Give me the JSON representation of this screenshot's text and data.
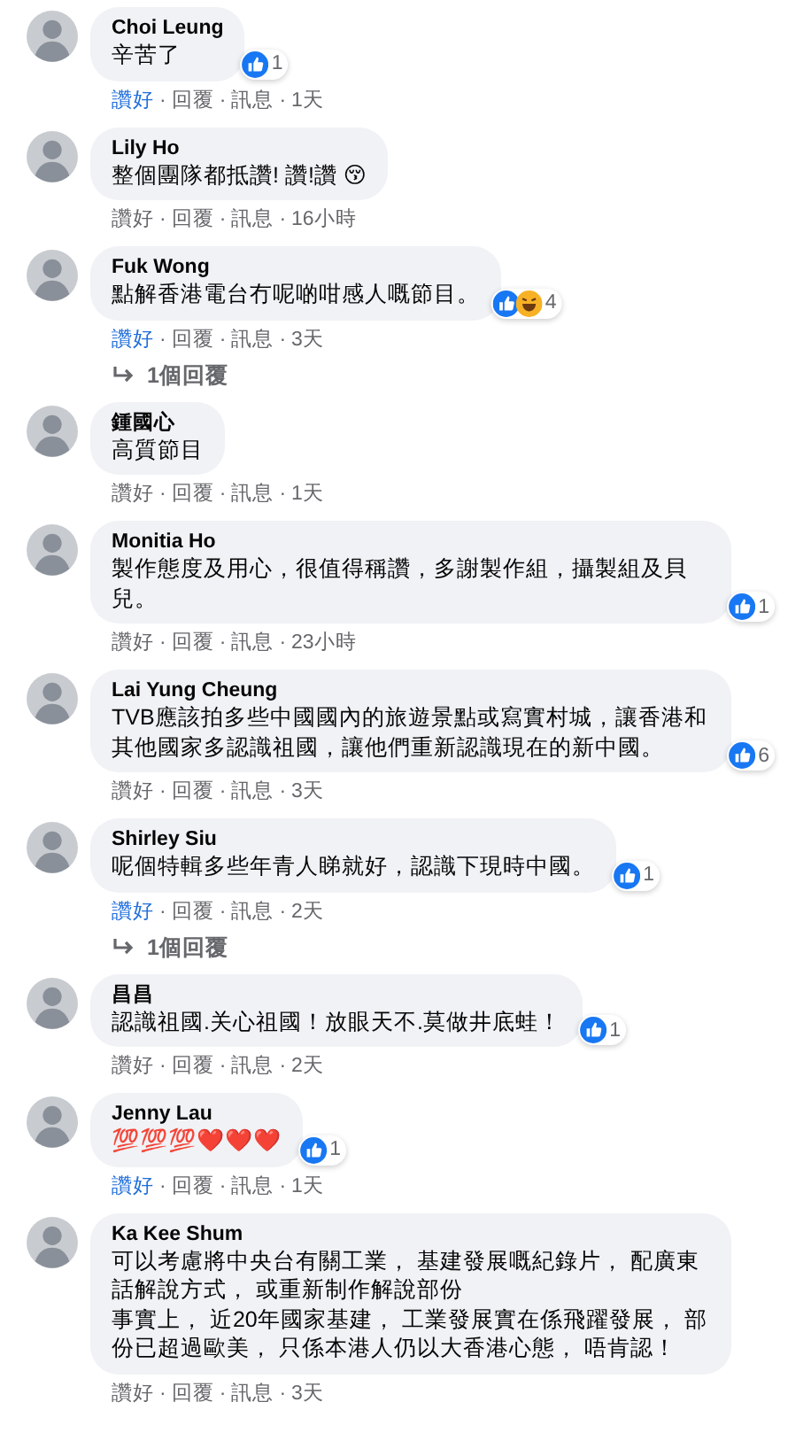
{
  "separator": "·",
  "comments": [
    {
      "name": "Choi Leung",
      "paragraphs": [
        "辛苦了"
      ],
      "liked": true,
      "like": "讚好",
      "reply": "回覆",
      "message": "訊息",
      "time": "1天",
      "reaction": {
        "like": true,
        "count": "1"
      }
    },
    {
      "name": "Lily Ho",
      "paragraphs": [
        "整個團隊都抵讚! 讚!讚 😚"
      ],
      "liked": false,
      "like": "讚好",
      "reply": "回覆",
      "message": "訊息",
      "time": "16小時"
    },
    {
      "name": "Fuk Wong",
      "paragraphs": [
        "點解香港電台冇呢啲咁感人嘅節目。"
      ],
      "liked": true,
      "like": "讚好",
      "reply": "回覆",
      "message": "訊息",
      "time": "3天",
      "reaction": {
        "like": true,
        "haha": true,
        "count": "4"
      },
      "replies": "1個回覆"
    },
    {
      "name": "鍾國心",
      "paragraphs": [
        "高質節目"
      ],
      "liked": false,
      "like": "讚好",
      "reply": "回覆",
      "message": "訊息",
      "time": "1天"
    },
    {
      "name": "Monitia Ho",
      "paragraphs": [
        "製作態度及用心，很值得稱讚，多謝製作組，攝製組及貝兒。"
      ],
      "liked": false,
      "like": "讚好",
      "reply": "回覆",
      "message": "訊息",
      "time": "23小時",
      "reaction": {
        "like": true,
        "count": "1"
      }
    },
    {
      "name": "Lai Yung Cheung",
      "paragraphs": [
        "TVB應該拍多些中國國內的旅遊景點或寫實村城，讓香港和其他國家多認識祖國，讓他們重新認識現在的新中國。"
      ],
      "liked": false,
      "like": "讚好",
      "reply": "回覆",
      "message": "訊息",
      "time": "3天",
      "reaction": {
        "like": true,
        "count": "6"
      }
    },
    {
      "name": "Shirley Siu",
      "paragraphs": [
        "呢個特輯多些年青人睇就好，認識下現時中國。"
      ],
      "liked": true,
      "like": "讚好",
      "reply": "回覆",
      "message": "訊息",
      "time": "2天",
      "reaction": {
        "like": true,
        "count": "1"
      },
      "replies": "1個回覆"
    },
    {
      "name": "昌昌",
      "paragraphs": [
        "認識祖國.关心祖國！放眼天不.莫做井底蛙！"
      ],
      "liked": false,
      "like": "讚好",
      "reply": "回覆",
      "message": "訊息",
      "time": "2天",
      "reaction": {
        "like": true,
        "count": "1"
      }
    },
    {
      "name": "Jenny Lau",
      "paragraphs": [
        "💯💯💯❤️❤️❤️"
      ],
      "liked": true,
      "like": "讚好",
      "reply": "回覆",
      "message": "訊息",
      "time": "1天",
      "reaction": {
        "like": true,
        "count": "1"
      }
    },
    {
      "name": "Ka Kee Shum",
      "paragraphs": [
        "可以考慮將中央台有關工業， 基建發展嘅紀錄片， 配廣東話解說方式， 或重新制作解說部份",
        "事實上， 近20年國家基建， 工業發展實在係飛躍發展， 部份已超過歐美， 只係本港人仍以大香港心態， 唔肯認！"
      ],
      "liked": false,
      "like": "讚好",
      "reply": "回覆",
      "message": "訊息",
      "time": "3天"
    }
  ]
}
